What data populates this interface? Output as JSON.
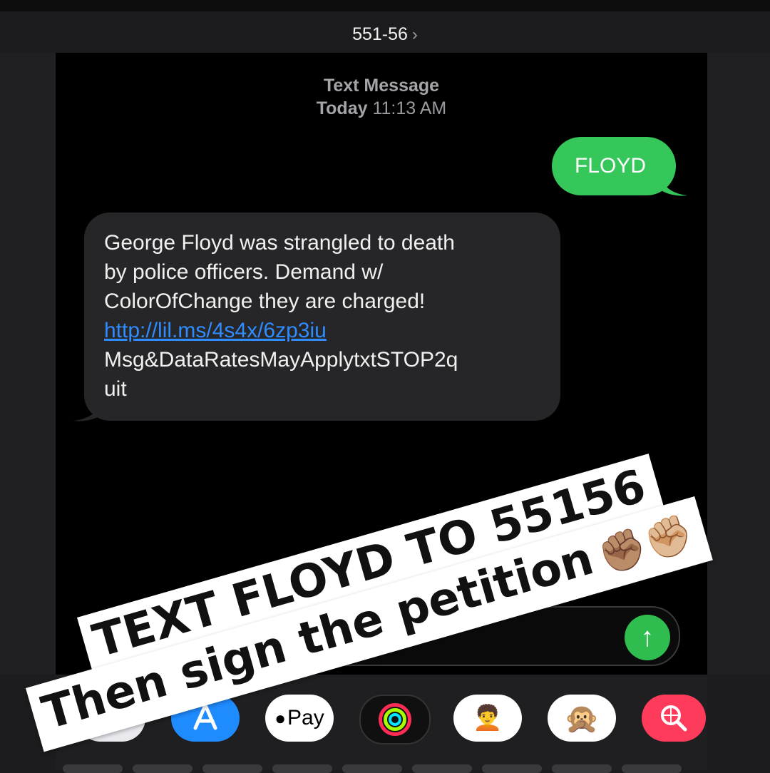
{
  "header": {
    "contact": "551-56",
    "chevron": "›"
  },
  "thread": {
    "service_label": "Text Message",
    "date_label": "Today",
    "time_label": "11:13 AM",
    "sent_message": "FLOYD",
    "received": {
      "line1": "George Floyd was strangled to death\nby police officers. Demand w/\nColorOfChange they are charged!\n",
      "link": "http://lil.ms/4s4x/6zp3iu",
      "line2": "\nMsg&DataRatesMayApplytxtSTOP2q\nuit"
    }
  },
  "composer": {
    "send_icon": "↑"
  },
  "app_tray": [
    {
      "name": "photos-app",
      "glyph": ""
    },
    {
      "name": "app-store",
      "glyph": "A"
    },
    {
      "name": "apple-pay",
      "glyph": "Pay"
    },
    {
      "name": "activity",
      "glyph": ""
    },
    {
      "name": "memoji",
      "glyph": "🧑‍🦱"
    },
    {
      "name": "animoji",
      "glyph": "🙊"
    },
    {
      "name": "image-search",
      "glyph": "⊕"
    }
  ],
  "stickers": {
    "line1": "TEXT FLOYD TO 55156",
    "line2": "Then sign the petition",
    "emoji": "✊🏽✊🏼"
  },
  "colors": {
    "sent_bubble": "#35c759",
    "received_bubble": "#262628",
    "link": "#2f8cff"
  }
}
